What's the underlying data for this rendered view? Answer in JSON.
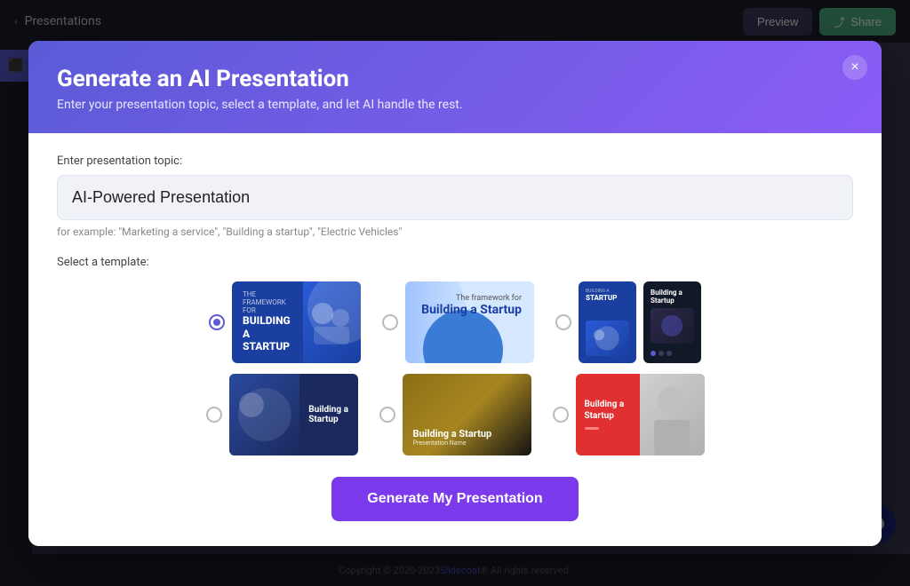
{
  "topBar": {
    "backLabel": "Presentations",
    "previewLabel": "Preview",
    "shareLabel": "Share"
  },
  "modal": {
    "title": "Generate an AI Presentation",
    "subtitle": "Enter your presentation topic, select a template, and let AI handle the rest.",
    "closeLabel": "×",
    "topicLabel": "Enter presentation topic:",
    "topicValue": "AI-Powered Presentation",
    "topicPlaceholder": "AI-Powered Presentation",
    "topicHint": "for example: \"Marketing a service\", \"Building a startup\", \"Electric Vehicles\"",
    "templateLabel": "Select a template:",
    "generateLabel": "Generate My Presentation",
    "templates": [
      {
        "id": "t1",
        "name": "Blue Startup Landscape",
        "selected": true
      },
      {
        "id": "t2",
        "name": "Light Blue Landscape",
        "selected": false
      },
      {
        "id": "t3",
        "name": "Blue Startup Portrait",
        "selected": false
      },
      {
        "id": "t4",
        "name": "Dark Portrait",
        "selected": false
      },
      {
        "id": "t5",
        "name": "Dark Blue Landscape",
        "selected": false
      },
      {
        "id": "t6",
        "name": "Yellow Landscape",
        "selected": false
      },
      {
        "id": "t7",
        "name": "Red Landscape",
        "selected": false
      }
    ]
  },
  "footer": {
    "copyright": "Copyright © 2020-2023 ",
    "brandName": "Slidecoat",
    "rights": "® All rights reserved."
  },
  "colors": {
    "modalHeaderStart": "#5b5bd6",
    "modalHeaderEnd": "#8b5cf6",
    "generateBtn": "#7c3aed",
    "previewBtn": "#3a3a5c",
    "shareBtn": "#4caf82"
  }
}
